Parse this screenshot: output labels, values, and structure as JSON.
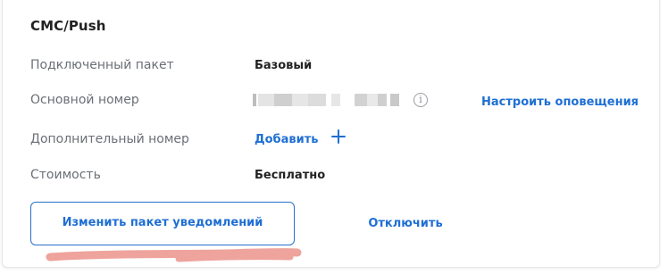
{
  "section": {
    "title": "СМС/Push"
  },
  "rows": {
    "package": {
      "label": "Подключенный пакет",
      "value": "Базовый"
    },
    "main_number": {
      "label": "Основной номер",
      "value": ""
    },
    "extra_number": {
      "label": "Дополнительный номер",
      "action": "Добавить"
    },
    "cost": {
      "label": "Стоимость",
      "value": "Бесплатно"
    }
  },
  "links": {
    "configure_alerts": "Настроить оповещения"
  },
  "buttons": {
    "change_package": "Изменить пакет уведомлений",
    "disable": "Отключить"
  },
  "icons": {
    "info": "info-icon",
    "plus": "plus-icon"
  },
  "colors": {
    "accent": "#1f6fd4",
    "text_primary": "#222222",
    "text_secondary": "#6b6f75",
    "annotation": "#e9a09a"
  }
}
